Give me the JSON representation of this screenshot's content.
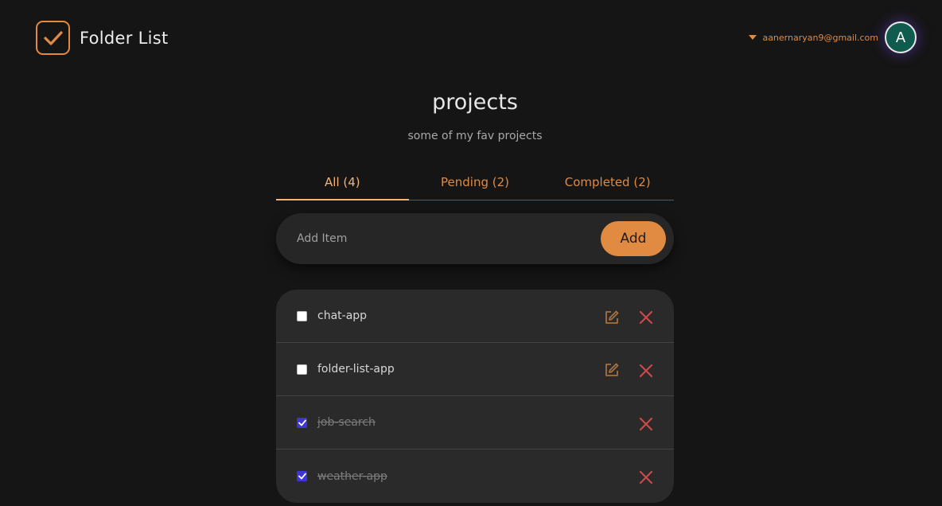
{
  "header": {
    "brand_title": "Folder List",
    "user_email": "aanernaryan9@gmail.com",
    "avatar_initial": "A"
  },
  "folder": {
    "title": "projects",
    "description": "some of my fav projects"
  },
  "tabs": [
    {
      "label": "All (4)",
      "active": true
    },
    {
      "label": "Pending (2)",
      "active": false
    },
    {
      "label": "Completed (2)",
      "active": false
    }
  ],
  "add_bar": {
    "placeholder": "Add Item",
    "value": "",
    "button_label": "Add"
  },
  "items": [
    {
      "label": "chat-app",
      "completed": false
    },
    {
      "label": "folder-list-app",
      "completed": false
    },
    {
      "label": "job-search",
      "completed": true
    },
    {
      "label": "weather-app",
      "completed": true
    }
  ],
  "colors": {
    "background": "#151515",
    "accent": "#e08a42",
    "delete": "#c94a4a",
    "checkbox_checked": "#3f35d6",
    "avatar": "#0f5c4f"
  },
  "icons": {
    "logo": "check-square-icon",
    "caret": "caret-down-icon",
    "edit": "edit-icon",
    "delete": "close-icon"
  }
}
